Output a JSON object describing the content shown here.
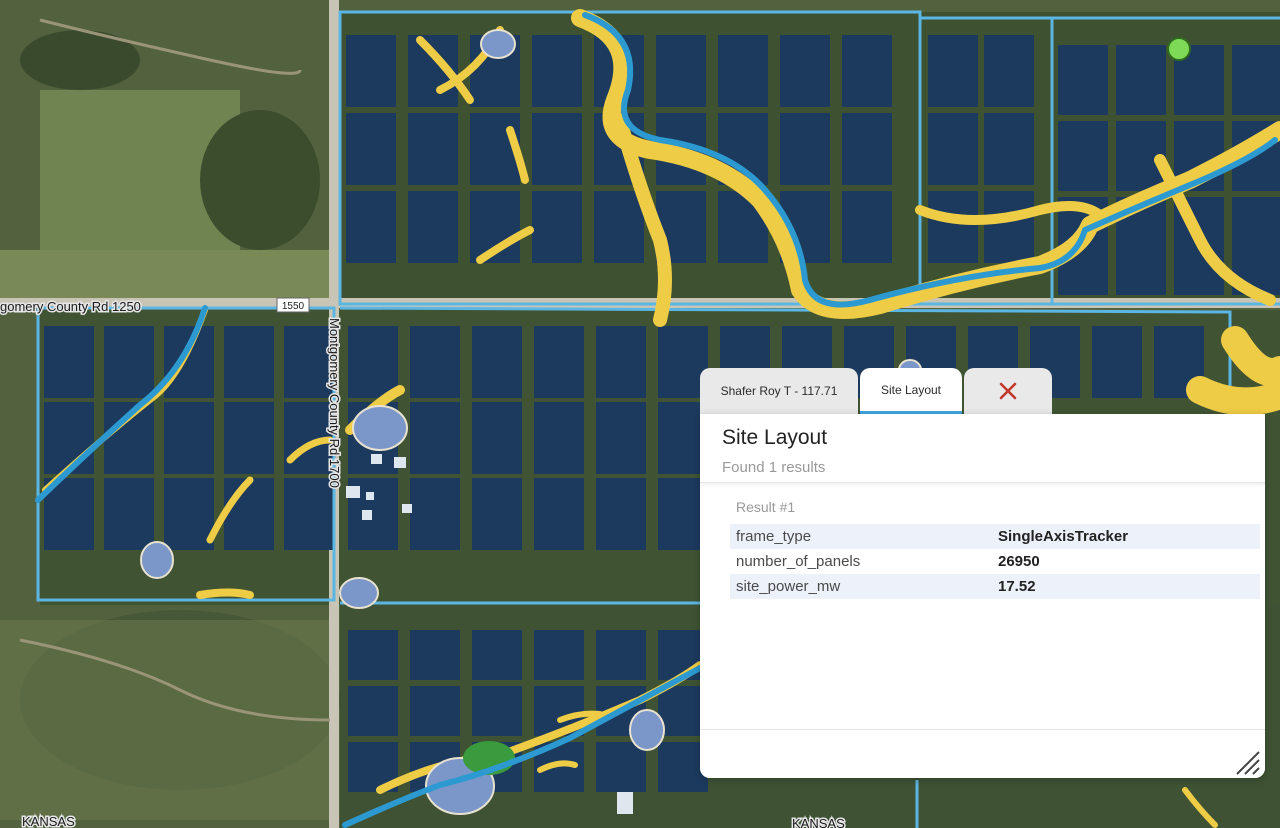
{
  "map": {
    "road_labels": {
      "county_rd_1250": "gomery County Rd 1250",
      "county_rd_1700": "Montgomery County Rd 1700",
      "shield_1550": "1550",
      "kansas_1": "KANSAS",
      "kansas_2": "KANSAS"
    },
    "colors": {
      "panel_block": "#1c3a5e",
      "parcel_outline": "#5bb6e3",
      "stream": "#2c9ad1",
      "wetland_buffer": "#efcc45",
      "pond": "#7b96c8",
      "green_feature": "#3a9b3e",
      "marker": "#7ed957"
    }
  },
  "popup": {
    "tabs": [
      {
        "label": "Shafer Roy T - 117.71"
      },
      {
        "label": "Site Layout"
      }
    ],
    "close_icon": "x-icon",
    "title": "Site Layout",
    "subtitle": "Found 1 results",
    "result_label": "Result #1",
    "rows": [
      {
        "key": "frame_type",
        "value": "SingleAxisTracker"
      },
      {
        "key": "number_of_panels",
        "value": "26950"
      },
      {
        "key": "site_power_mw",
        "value": "17.52"
      }
    ]
  }
}
